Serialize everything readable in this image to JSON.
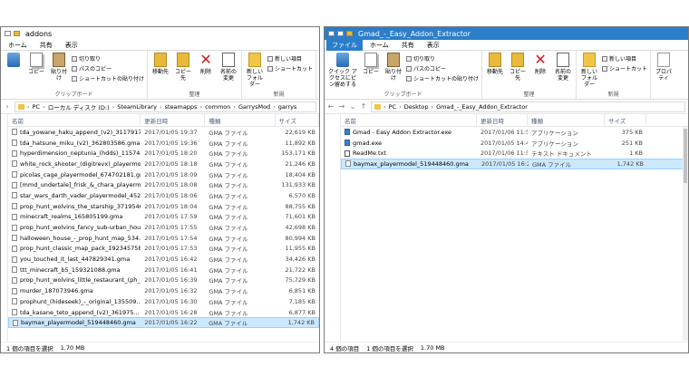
{
  "left": {
    "title": "addons",
    "tabs": [
      "ホーム",
      "共有",
      "表示"
    ],
    "ribbon": {
      "pin": "クイック アクセスにピン留めする",
      "copy": "コピー",
      "paste": "貼り付け",
      "cut": "切り取り",
      "copy_path": "パスのコピー",
      "paste_shortcut": "ショートカットの貼り付け",
      "clipboard": "クリップボード",
      "move_to": "移動先",
      "copy_to": "コピー先",
      "delete": "削除",
      "rename": "名前の変更",
      "organize": "整理",
      "new_folder": "新しいフォルダー",
      "new_item": "新しい項目",
      "shortcut": "ショートカット",
      "new": "新規"
    },
    "breadcrumb": [
      "PC",
      "ローカル ディスク (D:)",
      "SteamLibrary",
      "steamapps",
      "common",
      "GarrysMod",
      "garrys"
    ],
    "columns": [
      "名前",
      "更新日時",
      "種類",
      "サイズ"
    ],
    "files": [
      {
        "name": "tda_yowane_haku_append_(v2)_31179177...",
        "date": "2017/01/05 19:37",
        "type": "GMA ファイル",
        "size": "22,619 KB"
      },
      {
        "name": "tda_hatsune_miku_(v2)_362803586.gma",
        "date": "2017/01/05 19:36",
        "type": "GMA ファイル",
        "size": "11,892 KB"
      },
      {
        "name": "hyperdimension_neptunia_(hdds)_115743...",
        "date": "2017/01/05 18:20",
        "type": "GMA ファイル",
        "size": "153,171 KB"
      },
      {
        "name": "white_rock_shooter_(digitrevx)_playermo...",
        "date": "2017/01/05 18:18",
        "type": "GMA ファイル",
        "size": "21,246 KB"
      },
      {
        "name": "picolas_cage_playermodel_674702181.gma",
        "date": "2017/01/05 18:09",
        "type": "GMA ファイル",
        "size": "18,404 KB"
      },
      {
        "name": "[mmd_undertale]_frisk_&_chara_playerm...",
        "date": "2017/01/05 18:08",
        "type": "GMA ファイル",
        "size": "131,933 KB"
      },
      {
        "name": "star_wars_darth_vader_playermodel_4520...",
        "date": "2017/01/05 18:06",
        "type": "GMA ファイル",
        "size": "6,570 KB"
      },
      {
        "name": "prop_hunt_wolvins_the_starship_3719546...",
        "date": "2017/01/05 18:04",
        "type": "GMA ファイル",
        "size": "88,755 KB"
      },
      {
        "name": "minecraft_realms_165805199.gma",
        "date": "2017/01/05 17:59",
        "type": "GMA ファイル",
        "size": "71,601 KB"
      },
      {
        "name": "prop_hunt_wolvins_fancy_sub-urban_hou...",
        "date": "2017/01/05 17:55",
        "type": "GMA ファイル",
        "size": "42,698 KB"
      },
      {
        "name": "halloween_house_-_prop_hunt_map_534...",
        "date": "2017/01/05 17:54",
        "type": "GMA ファイル",
        "size": "80,994 KB"
      },
      {
        "name": "prop_hunt_classic_map_pack_192345758...",
        "date": "2017/01/05 17:53",
        "type": "GMA ファイル",
        "size": "11,955 KB"
      },
      {
        "name": "you_touched_it_last_447829341.gma",
        "date": "2017/01/05 16:42",
        "type": "GMA ファイル",
        "size": "34,426 KB"
      },
      {
        "name": "ttt_minecraft_b5_159321088.gma",
        "date": "2017/01/05 16:41",
        "type": "GMA ファイル",
        "size": "21,722 KB"
      },
      {
        "name": "prop_hunt_wolvins_little_restaurant_(ph_...",
        "date": "2017/01/05 16:39",
        "type": "GMA ファイル",
        "size": "75,729 KB"
      },
      {
        "name": "murder_187073946.gma",
        "date": "2017/01/05 16:32",
        "type": "GMA ファイル",
        "size": "6,851 KB"
      },
      {
        "name": "prophunt_(hideseek)_-_original_135509...",
        "date": "2017/01/05 16:30",
        "type": "GMA ファイル",
        "size": "7,185 KB"
      },
      {
        "name": "tda_kasane_teto_append_(v2)_361975...",
        "date": "2017/01/05 16:28",
        "type": "GMA ファイル",
        "size": "6,877 KB"
      },
      {
        "name": "baymax_playermodel_519448460.gma",
        "date": "2017/01/05 16:22",
        "type": "GMA ファイル",
        "size": "1,742 KB",
        "selected": true
      }
    ],
    "status_count": "1 個の項目を選択",
    "status_size": "1.70 MB"
  },
  "right": {
    "title": "Gmad_-_Easy_Addon_Extractor",
    "tabs": [
      "ファイル",
      "ホーム",
      "共有",
      "表示"
    ],
    "ribbon": {
      "pin": "クイック アクセスにピン留めする",
      "copy": "コピー",
      "paste": "貼り付け",
      "cut": "切り取り",
      "copy_path": "パスのコピー",
      "paste_shortcut": "ショートカットの貼り付け",
      "clipboard": "クリップボード",
      "move_to": "移動先",
      "copy_to": "コピー先",
      "delete": "削除",
      "rename": "名前の変更",
      "organize": "整理",
      "new_folder": "新しいフォルダー",
      "new_item": "新しい項目",
      "shortcut": "ショートカット",
      "new": "新規",
      "properties": "プロパティ"
    },
    "breadcrumb": [
      "PC",
      "Desktop",
      "Gmad_-_Easy_Addon_Extractor"
    ],
    "columns": [
      "名前",
      "更新日時",
      "種類",
      "サイズ"
    ],
    "files": [
      {
        "name": "Gmad - Easy Addon Extractor.exe",
        "date": "2017/01/06 11:59",
        "type": "アプリケーション",
        "size": "375 KB",
        "icon": "exe"
      },
      {
        "name": "gmad.exe",
        "date": "2017/01/05 14:46",
        "type": "アプリケーション",
        "size": "251 KB",
        "icon": "exe"
      },
      {
        "name": "ReadMe.txt",
        "date": "2017/01/06 11:59",
        "type": "テキスト ドキュメント",
        "size": "1 KB",
        "icon": "txt"
      },
      {
        "name": "baymax_playermodel_519448460.gma",
        "date": "2017/01/05 16:22",
        "type": "GMA ファイル",
        "size": "1,742 KB",
        "icon": "gma",
        "selected": true
      }
    ],
    "status_count": "4 個の項目",
    "status_sel": "1 個の項目を選択",
    "status_size": "1.70 MB"
  }
}
